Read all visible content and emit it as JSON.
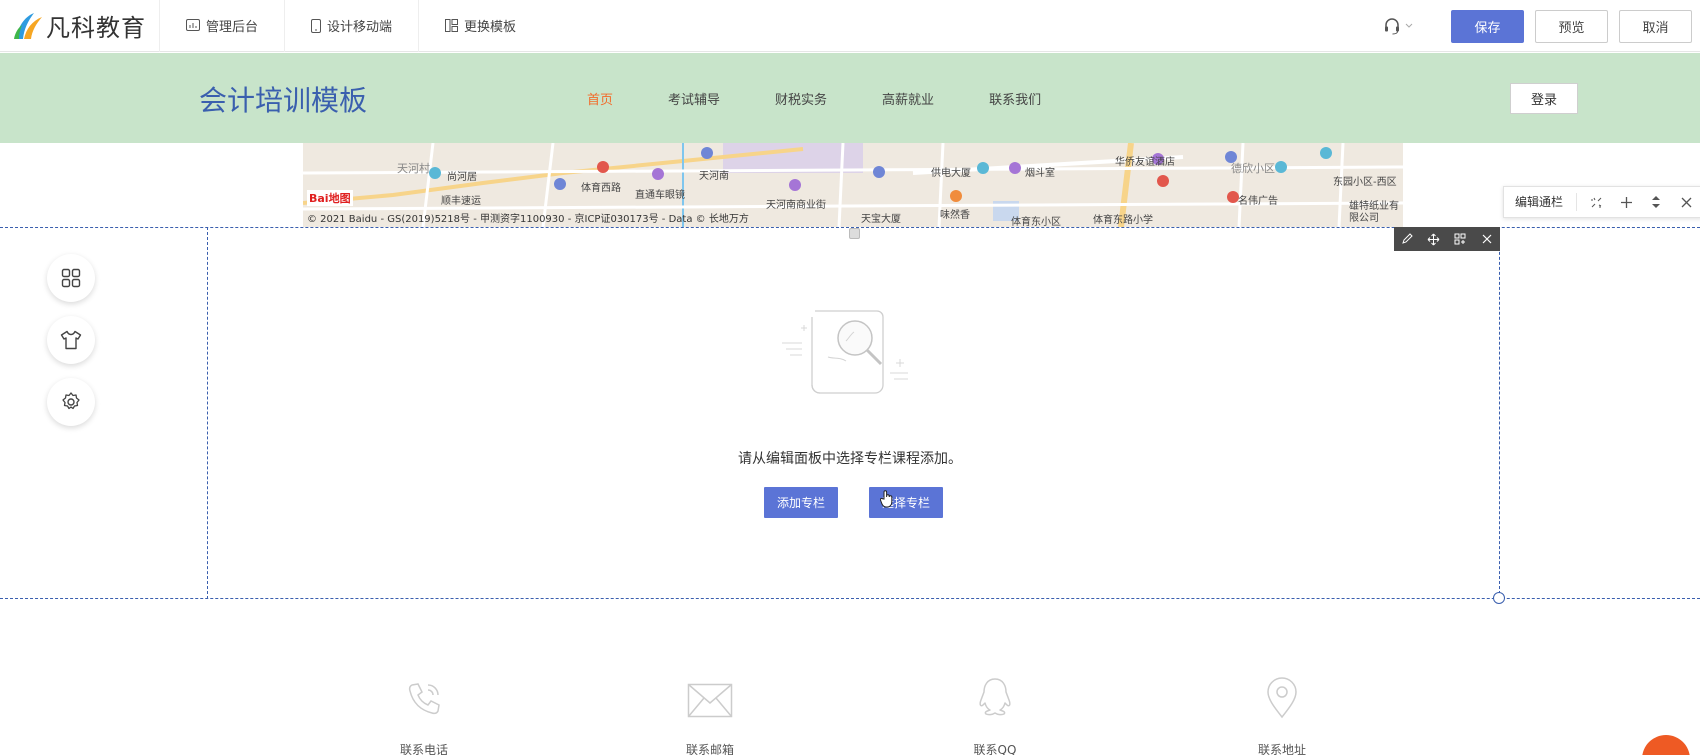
{
  "topbar": {
    "brand": "凡科教育",
    "items": [
      {
        "label": "管理后台",
        "icon": "dashboard-icon"
      },
      {
        "label": "设计移动端",
        "icon": "mobile-icon"
      },
      {
        "label": "更换模板",
        "icon": "template-icon"
      }
    ],
    "save_label": "保存",
    "preview_label": "预览",
    "cancel_label": "取消"
  },
  "site": {
    "title": "会计培训模板",
    "nav": [
      "首页",
      "考试辅导",
      "财税实务",
      "高薪就业",
      "联系我们"
    ],
    "active_nav": 0,
    "login_label": "登录"
  },
  "map": {
    "copyright": "© 2021 Baidu - GS(2019)5218号 - 甲测资字1100930 - 京ICP证030173号 - Data © 长地万方",
    "labels": [
      "天河村",
      "尚河居",
      "顺丰速运",
      "体育西路",
      "天河南",
      "直通车眼镜",
      "天河南商业街",
      "天宝大厦",
      "供电大厦",
      "烟斗室",
      "味然香",
      "华侨友谊酒店",
      "体育东小区",
      "体育东路小学",
      "德欣小区",
      "名伟广告",
      "东园小区-西区",
      "雄特纸业有限公司"
    ],
    "logo_text": "Bai地图"
  },
  "edit_toolbar": {
    "label": "编辑通栏"
  },
  "module": {
    "empty_message": "请从编辑面板中选择专栏课程添加。",
    "add_label": "添加专栏",
    "select_label": "选择专栏"
  },
  "contacts": [
    {
      "label": "联系电话",
      "icon": "phone-icon"
    },
    {
      "label": "联系邮箱",
      "icon": "mail-icon"
    },
    {
      "label": "联系QQ",
      "icon": "qq-icon"
    },
    {
      "label": "联系地址",
      "icon": "location-icon"
    }
  ],
  "colors": {
    "accent": "#5b74d6",
    "header_bg": "#c8e4ca",
    "title": "#3a5fae",
    "active_nav": "#f26b2b"
  }
}
